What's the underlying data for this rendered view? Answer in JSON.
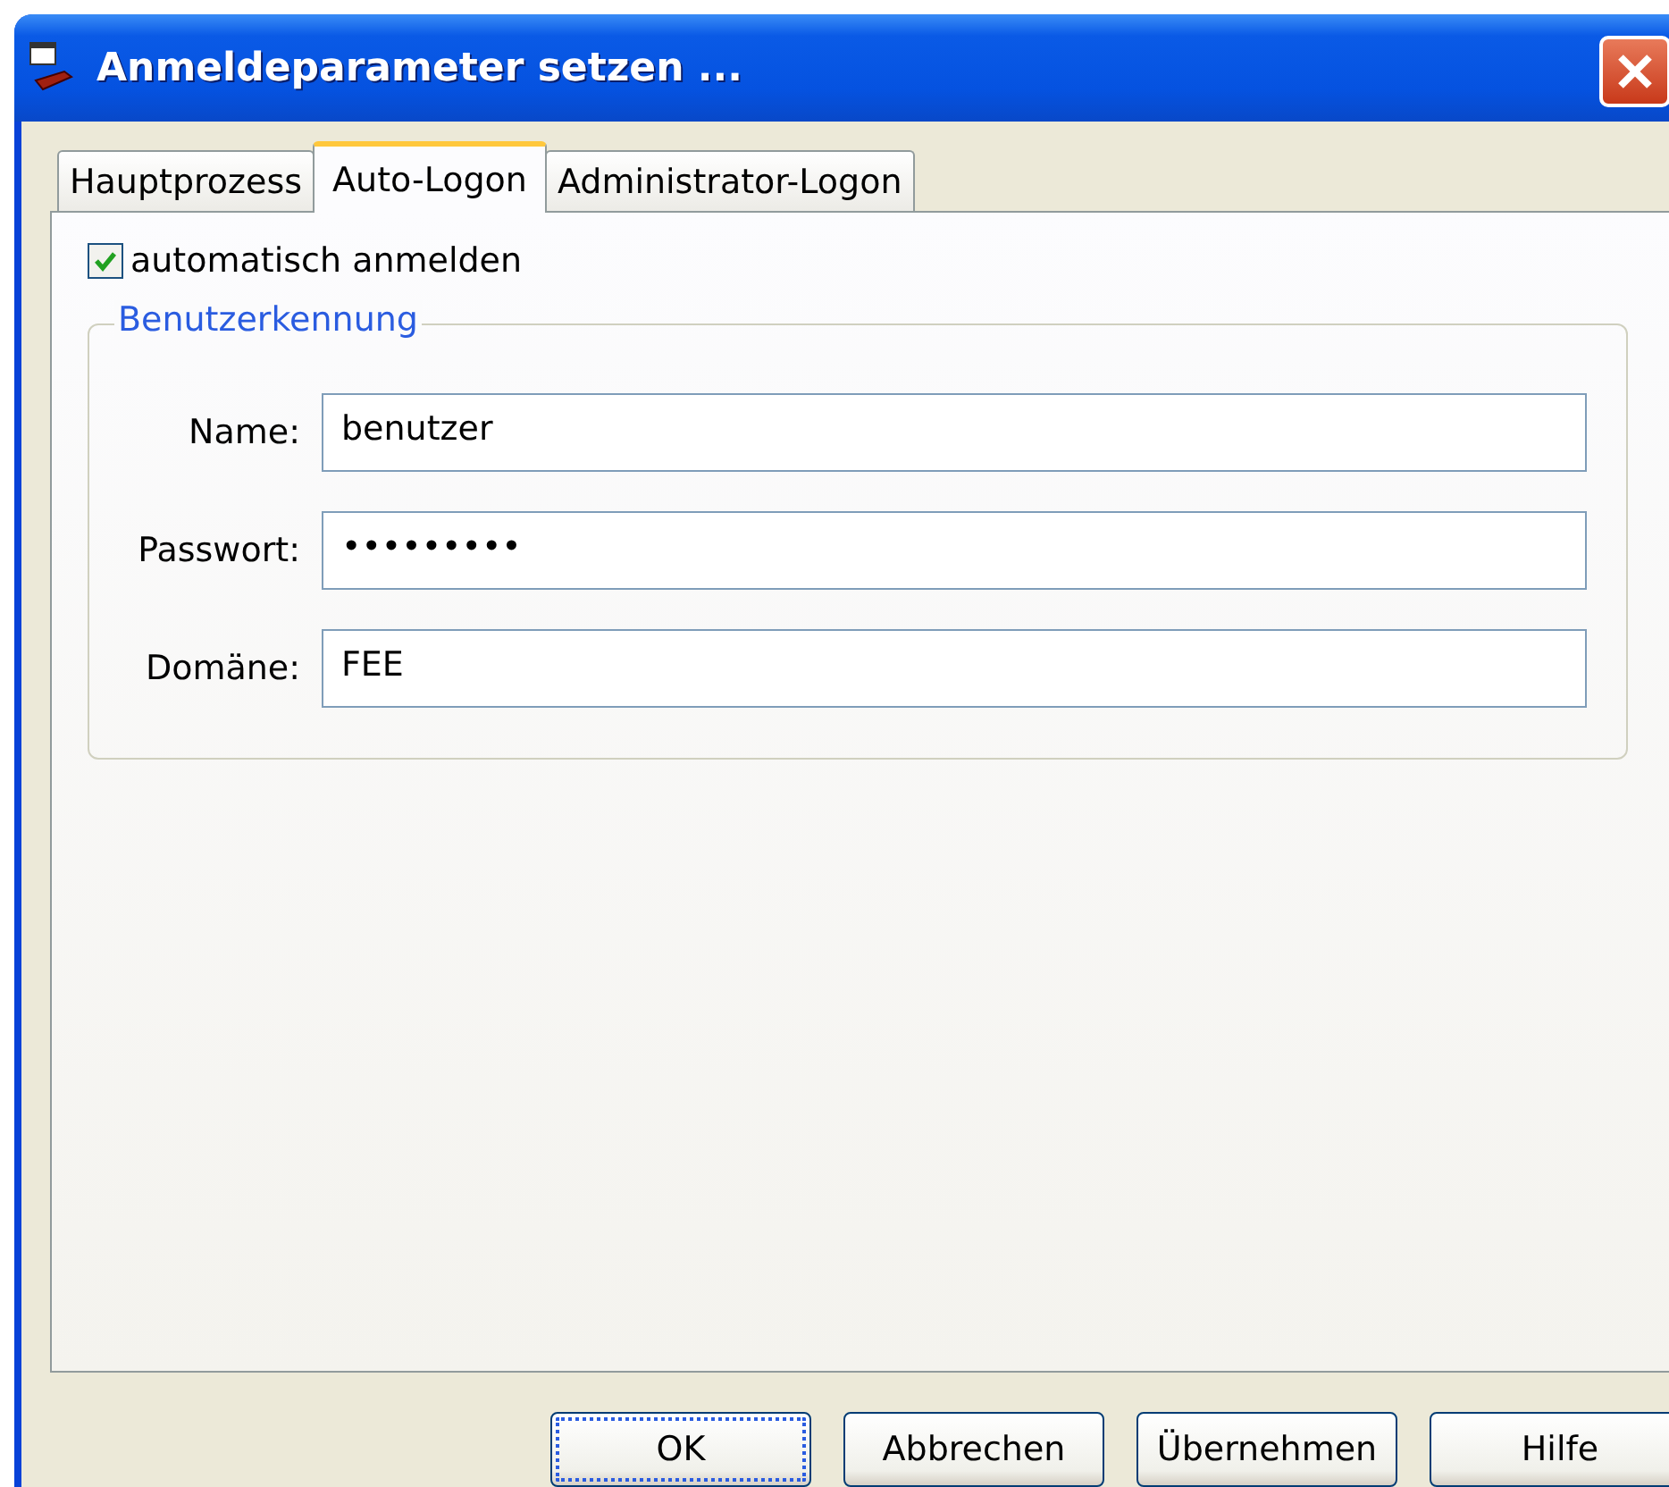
{
  "window": {
    "title": "Anmeldeparameter setzen ..."
  },
  "tabs": [
    {
      "label": "Hauptprozess",
      "selected": false
    },
    {
      "label": "Auto-Logon",
      "selected": true
    },
    {
      "label": "Administrator-Logon",
      "selected": false
    }
  ],
  "auto_login": {
    "label": "automatisch anmelden",
    "checked": true
  },
  "group": {
    "title": "Benutzerkennung",
    "fields": [
      {
        "label": "Name:",
        "value": "benutzer"
      },
      {
        "label": "Passwort:",
        "value": "•••••••••"
      },
      {
        "label": "Domäne:",
        "value": "FEE"
      }
    ]
  },
  "buttons": [
    {
      "label": "OK",
      "default": true
    },
    {
      "label": "Abbrechen",
      "default": false
    },
    {
      "label": "Übernehmen",
      "default": false
    },
    {
      "label": "Hilfe",
      "default": false
    }
  ]
}
